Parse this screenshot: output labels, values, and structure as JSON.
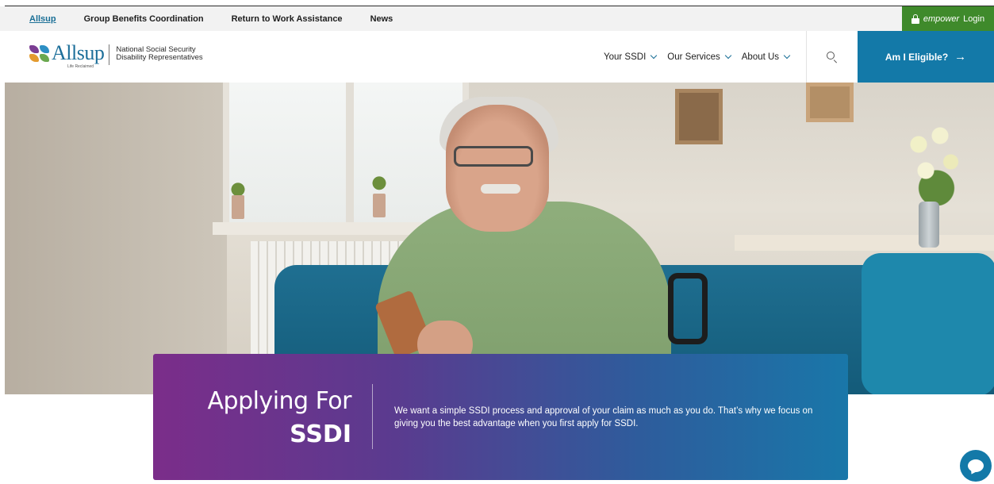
{
  "topbar": {
    "links": [
      {
        "label": "Allsup",
        "active": true
      },
      {
        "label": "Group Benefits Coordination",
        "active": false
      },
      {
        "label": "Return to Work Assistance",
        "active": false
      },
      {
        "label": "News",
        "active": false
      }
    ],
    "login": {
      "brand": "empower",
      "label": "Login",
      "icon": "lock-icon"
    }
  },
  "header": {
    "logo": {
      "word": "Allsup",
      "tagline": "Life Reclaimed",
      "subtitle_line1": "National Social Security",
      "subtitle_line2": "Disability Representatives"
    },
    "nav": [
      {
        "label": "Your SSDI",
        "icon": "chevron-down-icon"
      },
      {
        "label": "Our Services",
        "icon": "chevron-down-icon"
      },
      {
        "label": "About Us",
        "icon": "chevron-down-icon"
      }
    ],
    "search_icon": "search-icon",
    "cta": {
      "label": "Am I Eligible?",
      "arrow": "→"
    }
  },
  "banner": {
    "title_line1": "Applying For",
    "title_line2": "SSDI",
    "body": "We want a simple SSDI process and approval of your claim as much as you do. That’s why we focus on giving you the best advantage when you first apply for SSDI."
  },
  "chat": {
    "icon": "chat-icon"
  },
  "colors": {
    "brand_blue": "#1379a8",
    "login_green": "#3f8a2b",
    "banner_gradient_start": "#7b2d8a",
    "banner_gradient_end": "#1977a9"
  }
}
